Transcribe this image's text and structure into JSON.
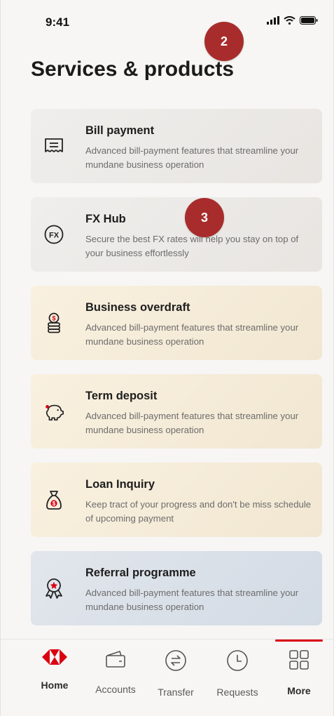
{
  "status_bar": {
    "time": "9:41"
  },
  "header": {
    "title": "Services & products"
  },
  "badges": [
    "2",
    "3"
  ],
  "cards": [
    {
      "title": "Bill payment",
      "description": "Advanced bill-payment features that streamline your mundane business operation",
      "icon": "receipt-icon"
    },
    {
      "title": "FX Hub",
      "description": "Secure the best FX rates will help you stay on top of your business effortlessly",
      "icon": "fx-icon"
    },
    {
      "title": "Business overdraft",
      "description": "Advanced bill-payment features that streamline your mundane business operation",
      "icon": "coins-icon"
    },
    {
      "title": "Term deposit",
      "description": "Advanced bill-payment features that streamline your mundane business operation",
      "icon": "piggy-bank-icon"
    },
    {
      "title": "Loan Inquiry",
      "description": "Keep tract of your progress and don't be miss schedule of upcoming payment",
      "icon": "money-bag-icon"
    },
    {
      "title": "Referral programme",
      "description": "Advanced bill-payment features that streamline your mundane business operation",
      "icon": "award-icon"
    }
  ],
  "tabs": [
    {
      "label": "Home",
      "icon": "hsbc-logo-icon"
    },
    {
      "label": "Accounts",
      "icon": "wallet-icon"
    },
    {
      "label": "Transfer",
      "icon": "transfer-icon"
    },
    {
      "label": "Requests",
      "icon": "clock-icon"
    },
    {
      "label": "More",
      "icon": "grid-icon"
    }
  ],
  "colors": {
    "brand_red": "#db0011",
    "badge": "#a82c2c"
  }
}
